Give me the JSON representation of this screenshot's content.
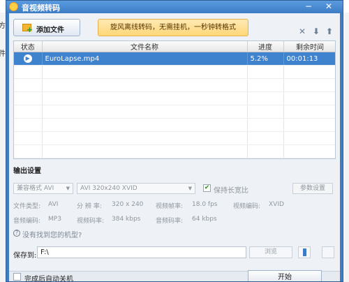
{
  "window": {
    "title": "音视频转码"
  },
  "toolbar": {
    "add_file_label": "添加文件",
    "promo_text": "旋风离线转码，无需挂机，一秒钟转格式"
  },
  "list": {
    "columns": [
      "状态",
      "文件名称",
      "进度",
      "剩余时间"
    ],
    "rows": [
      {
        "status_icon": "play-icon",
        "name": "EuroLapse.mp4",
        "progress": "5.2%",
        "remaining": "00:01:13"
      }
    ],
    "selected_row": 0
  },
  "output": {
    "section_title": "输出设置",
    "format": "兼容格式 AVI",
    "preset": "AVI 320x240 XVID",
    "keep_ratio_label": "保持长宽比",
    "keep_ratio_checked": true,
    "params_button": "参数设置",
    "info_row1": [
      {
        "label": "文件类型:",
        "value": "AVI"
      },
      {
        "label": "分 辨 率:",
        "value": "320 x 240"
      },
      {
        "label": "视频帧率:",
        "value": "18.0 fps"
      },
      {
        "label": "视频编码:",
        "value": "XVID"
      }
    ],
    "info_row2": [
      {
        "label": "音频编码:",
        "value": "MP3"
      },
      {
        "label": "视频码率:",
        "value": "384 kbps"
      },
      {
        "label": "音频码率:",
        "value": "64 kbps"
      }
    ],
    "help_link": "没有找到您的机型?"
  },
  "save": {
    "label": "保存到:",
    "path": "F:\\",
    "browse_label": "浏览"
  },
  "footer": {
    "shutdown_label": "完成后自动关机",
    "start_button": "开始"
  },
  "window_edge": {
    "left_chars": [
      "方",
      "件"
    ]
  },
  "colors": {
    "titlebar": "#3d7cc4",
    "selection": "#3f82cd",
    "promo": "#ffd778"
  }
}
